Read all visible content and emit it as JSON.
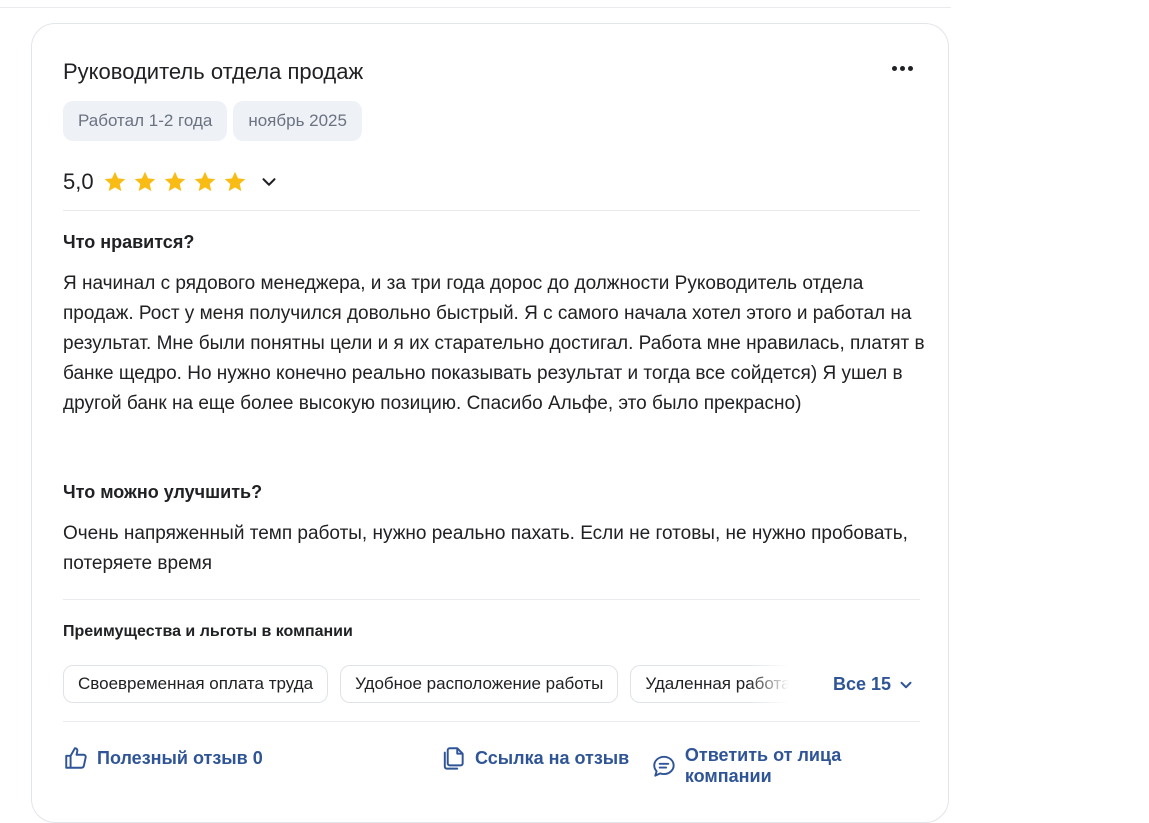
{
  "review": {
    "title": "Руководитель отдела продаж",
    "tags": [
      "Работал 1-2 года",
      "ноябрь 2025"
    ],
    "rating": "5,0",
    "rating_stars": 5,
    "star_color": "#f9bc15",
    "likes_title": "Что нравится?",
    "likes_text": "Я начинал с рядового менеджера, и за три года дорос до должности Руководитель отдела продаж. Рост у меня получился довольно быстрый. Я с самого начала хотел этого и работал на результат. Мне были понятны цели и я их старательно достигал. Работа мне нравилась, платят в банке щедро. Но нужно конечно реально показывать результат и тогда все сойдется) Я ушел в другой банк на еще более высокую позицию. Спасибо Альфе, это было прекрасно)",
    "improve_title": "Что можно улучшить?",
    "improve_text": "Очень напряженный темп работы, нужно реально пахать. Если не готовы, не нужно пробовать, потеряете время",
    "benefits_title": "Преимущества и льготы в компании",
    "benefits": [
      "Своевременная оплата труда",
      "Удобное расположение работы",
      "Удаленная работа"
    ],
    "benefits_all": "Все 15",
    "actions": {
      "helpful": "Полезный отзыв 0",
      "link": "Ссылка на отзыв",
      "reply": "Ответить от лица компании"
    },
    "accent_color": "#2f5597"
  }
}
